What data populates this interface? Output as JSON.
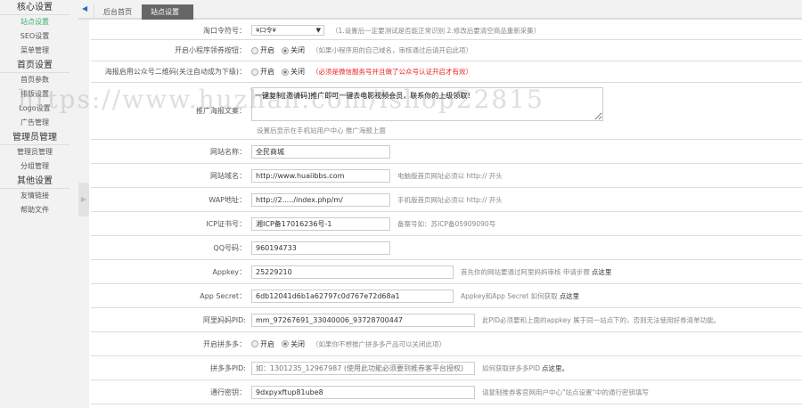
{
  "sidebar": {
    "sections": [
      {
        "title": "核心设置",
        "items": [
          "站点设置",
          "SEO设置",
          "菜单管理"
        ]
      },
      {
        "title": "首页设置",
        "items": [
          "首页参数",
          "排版设置",
          "Logo设置",
          "广告管理"
        ]
      },
      {
        "title": "管理员管理",
        "items": [
          "管理员管理",
          "分组管理"
        ]
      },
      {
        "title": "其他设置",
        "items": [
          "友情链接",
          "帮助文件"
        ]
      }
    ],
    "active": "站点设置"
  },
  "tabs": [
    {
      "label": "后台首页"
    },
    {
      "label": "站点设置",
      "close": "×"
    }
  ],
  "form": {
    "taokouling": {
      "label": "淘口令符号：",
      "value": "¥口令¥",
      "hint": "（1.设置后一定要测试是否能正常识别 2.修改后要清空商品重新采集）"
    },
    "mini_coupon": {
      "label": "开启小程序领券按钮：",
      "on": "开启",
      "off": "关闭",
      "hint": "（如果小程序用的自己域名，审核通过后请开启此项）"
    },
    "poster_qr": {
      "label": "海报启用公众号二维码(关注自动成为下级)：",
      "on": "开启",
      "off": "关闭",
      "hint": "（必须是微信服务号并且做了公众号认证开启才有效）"
    },
    "poster_text": {
      "label": "推广海报文案：",
      "value": "一键复制[邀请码]推广即可一键去电影视频会员，联系你的上级领取！",
      "hint": "设置后显示在手机站用户中心 推广海报上面"
    },
    "site_name": {
      "label": "网站名称：",
      "value": "全民商城"
    },
    "domain": {
      "label": "网站域名：",
      "value": "http://www.huaiibbs.com",
      "hint": "电脑版首页网址必须以 http:// 开头"
    },
    "wap": {
      "label": "WAP地址：",
      "value": "http://2...../index.php/m/",
      "hint": "手机版首页网址必须以 http:// 开头"
    },
    "icp": {
      "label": "ICP证书号：",
      "value": "湘ICP备17016236号-1",
      "hint": "备案号如：苏ICP备05909090号"
    },
    "qq": {
      "label": "QQ号码：",
      "value": "960194733"
    },
    "appkey": {
      "label": "Appkey：",
      "value": "25229210",
      "hint": "首先你的网站要通过阿里妈妈审核 申请步骤",
      "link": "点这里"
    },
    "secret": {
      "label": "App Secret：",
      "value": "6db12041d6b1a62797c0d767e72d68a1",
      "hint": "Appkey和App Secret 如何获取",
      "link": "点这里"
    },
    "pid": {
      "label": "阿里妈妈PID:",
      "value": "mm_97267691_33040006_93728700447",
      "hint": "此PID必须要和上面的appkey 属于同一站点下的，否则无法使用好券清单功能。"
    },
    "pdd": {
      "label": "开启拼多多：",
      "on": "开启",
      "off": "关闭",
      "hint": "（如果你不想推广拼多多产品可以关闭此项）"
    },
    "pdd_pid": {
      "label": "拼多多PID:",
      "placeholder": "如：1301235_12967987 (使用此功能必须要到推券客平台授权)",
      "hint": "如何获取拼多多PID",
      "link": "点这里。"
    },
    "pass_key": {
      "label": "通行密钥：",
      "value": "9dxpyxftup81ube8",
      "hint": "请复制推券客官网用户中心\"站点设置\"中的通行密钥填写"
    }
  },
  "watermark": "https://www.huzhan.com/ishop22815"
}
